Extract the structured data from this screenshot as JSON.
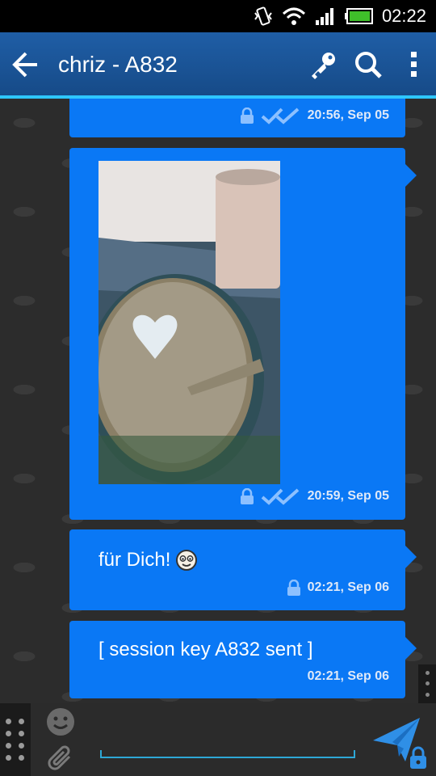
{
  "status_bar": {
    "time": "02:22",
    "icons": [
      "vibrate-icon",
      "wifi-icon",
      "signal-icon",
      "battery-icon"
    ]
  },
  "action_bar": {
    "title": "chriz - A832",
    "icons": [
      "back-arrow-icon",
      "key-icon",
      "search-icon",
      "overflow-menu-icon"
    ]
  },
  "messages": [
    {
      "type": "text",
      "text": "",
      "time": "20:56, Sep 05",
      "encrypted": true,
      "delivered": true
    },
    {
      "type": "image",
      "image_desc": "",
      "time": "20:59, Sep 05",
      "encrypted": true,
      "delivered": true
    },
    {
      "type": "text",
      "text": "für Dich! ",
      "emoji": "smiley-emoji",
      "time": "02:21, Sep 06",
      "encrypted": true,
      "delivered": false
    },
    {
      "type": "text",
      "text": "[ session key A832 sent ]",
      "time": "02:21, Sep 06",
      "encrypted": false,
      "delivered": false
    }
  ],
  "input_bar": {
    "placeholder": "",
    "value": "",
    "icons": [
      "smiley-icon",
      "paperclip-icon",
      "send-encrypted-icon"
    ]
  },
  "colors": {
    "bubble": "#0a78f5",
    "action_bar": "#1f5ea6",
    "accent_line": "#2ec6ff",
    "battery": "#3fbf2a"
  }
}
